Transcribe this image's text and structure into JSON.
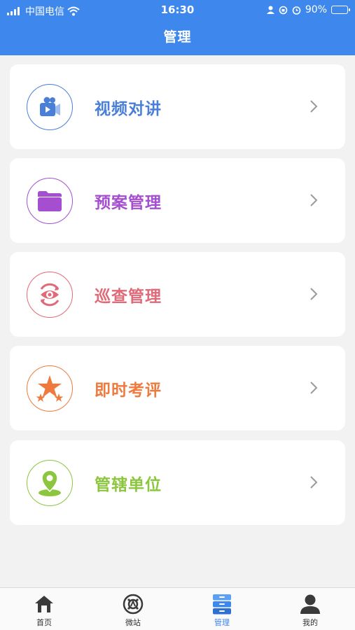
{
  "status_bar": {
    "carrier": "中国电信",
    "time": "16:30",
    "battery_percent": "90%",
    "battery_level": 0.9
  },
  "header": {
    "title": "管理"
  },
  "menu": [
    {
      "label": "视频对讲",
      "icon": "video-camera-icon",
      "color": "#4a7fd8"
    },
    {
      "label": "预案管理",
      "icon": "folder-icon",
      "color": "#a54fd0"
    },
    {
      "label": "巡查管理",
      "icon": "eye-refresh-icon",
      "color": "#e06a78"
    },
    {
      "label": "即时考评",
      "icon": "stars-icon",
      "color": "#ee7a3e"
    },
    {
      "label": "管辖单位",
      "icon": "location-pin-icon",
      "color": "#8cc63f"
    }
  ],
  "tabbar": {
    "items": [
      {
        "label": "首页",
        "icon": "home-icon"
      },
      {
        "label": "微站",
        "icon": "station-icon"
      },
      {
        "label": "管理",
        "icon": "manage-drawer-icon",
        "active": true
      },
      {
        "label": "我的",
        "icon": "user-icon"
      }
    ],
    "active_color": "#3e87ec"
  },
  "colors": {
    "header_bg": "#3e87ec",
    "page_bg": "#f2f2f2",
    "card_bg": "#ffffff"
  }
}
